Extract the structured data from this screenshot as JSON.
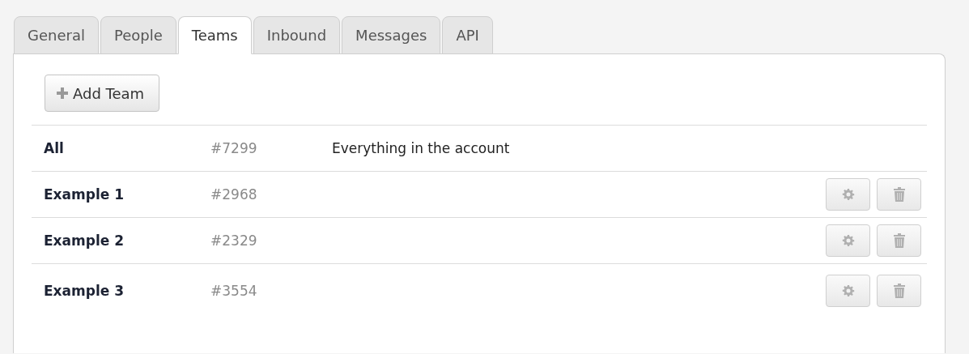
{
  "tabs": [
    {
      "label": "General",
      "selected": false
    },
    {
      "label": "People",
      "selected": false
    },
    {
      "label": "Teams",
      "selected": true
    },
    {
      "label": "Inbound",
      "selected": false
    },
    {
      "label": "Messages",
      "selected": false
    },
    {
      "label": "API",
      "selected": false
    }
  ],
  "add_button": {
    "label": "Add Team"
  },
  "teams": [
    {
      "name": "All",
      "id": "#7299",
      "description": "Everything in the account",
      "actions": false
    },
    {
      "name": "Example 1",
      "id": "#2968",
      "actions": true
    },
    {
      "name": "Example 2",
      "id": "#2329",
      "actions": true
    },
    {
      "name": "Example 3",
      "id": "#3554",
      "actions": true
    }
  ]
}
